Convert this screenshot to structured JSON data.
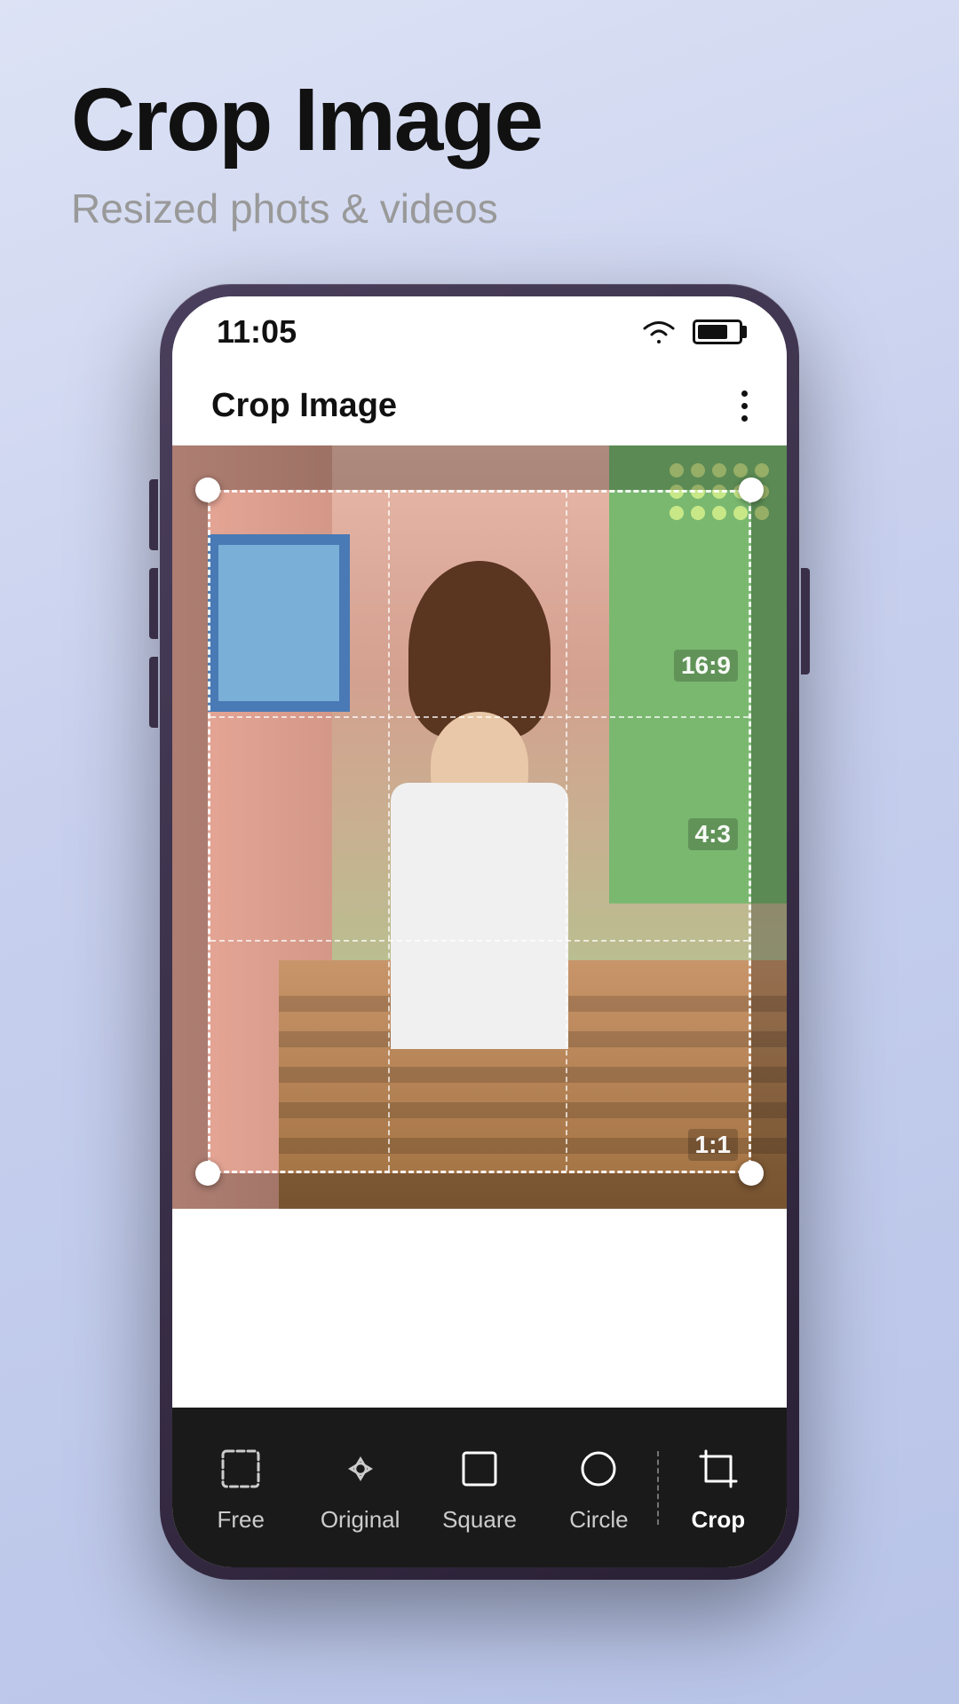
{
  "page": {
    "title": "Crop Image",
    "subtitle": "Resized phots & videos",
    "background_gradient_start": "#dde3f5",
    "background_gradient_end": "#b8c4e8"
  },
  "status_bar": {
    "time": "11:05",
    "wifi_label": "wifi",
    "battery_label": "battery"
  },
  "app_header": {
    "title": "Crop Image",
    "menu_label": "more options"
  },
  "crop_editor": {
    "ratio_labels": [
      "16:9",
      "4:3",
      "1:1"
    ]
  },
  "toolbar": {
    "items": [
      {
        "id": "free",
        "label": "Free",
        "active": false
      },
      {
        "id": "original",
        "label": "Original",
        "active": false
      },
      {
        "id": "square",
        "label": "Square",
        "active": false
      },
      {
        "id": "circle",
        "label": "Circle",
        "active": false
      },
      {
        "id": "crop",
        "label": "Crop",
        "active": true
      }
    ]
  }
}
